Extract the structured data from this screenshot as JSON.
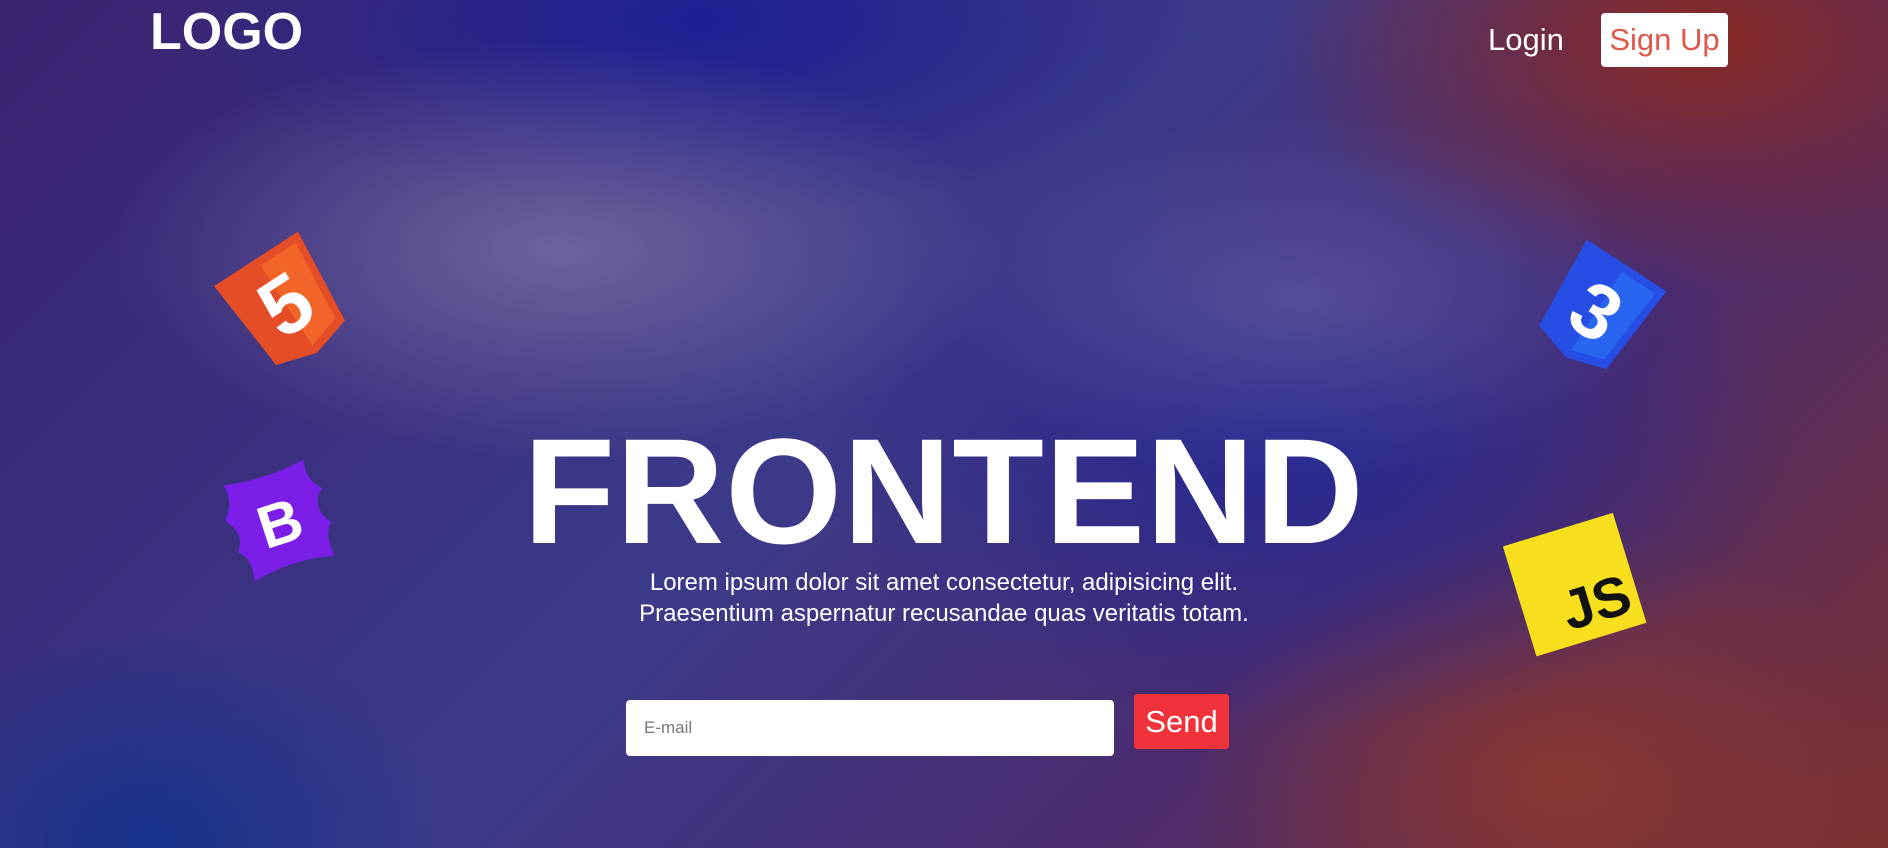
{
  "nav": {
    "logo": "LOGO",
    "login": "Login",
    "signup": "Sign Up"
  },
  "hero": {
    "title": "FRONTEND",
    "text_line1": "Lorem ipsum dolor sit amet consectetur, adipisicing elit.",
    "text_line2": "Praesentium aspernatur recusandae quas veritatis totam."
  },
  "form": {
    "email_placeholder": "E-mail",
    "email_value": "",
    "send": "Send"
  },
  "badges": {
    "html5": {
      "icon": "html5-icon",
      "glyph": "5",
      "color": "#e44d26"
    },
    "css3": {
      "icon": "css3-icon",
      "glyph": "3",
      "color": "#2a5ce6"
    },
    "bootstrap": {
      "icon": "bootstrap-icon",
      "glyph": "B",
      "color": "#7b1fe8"
    },
    "javascript": {
      "icon": "javascript-icon",
      "glyph": "JS",
      "color": "#f7df1e"
    }
  }
}
